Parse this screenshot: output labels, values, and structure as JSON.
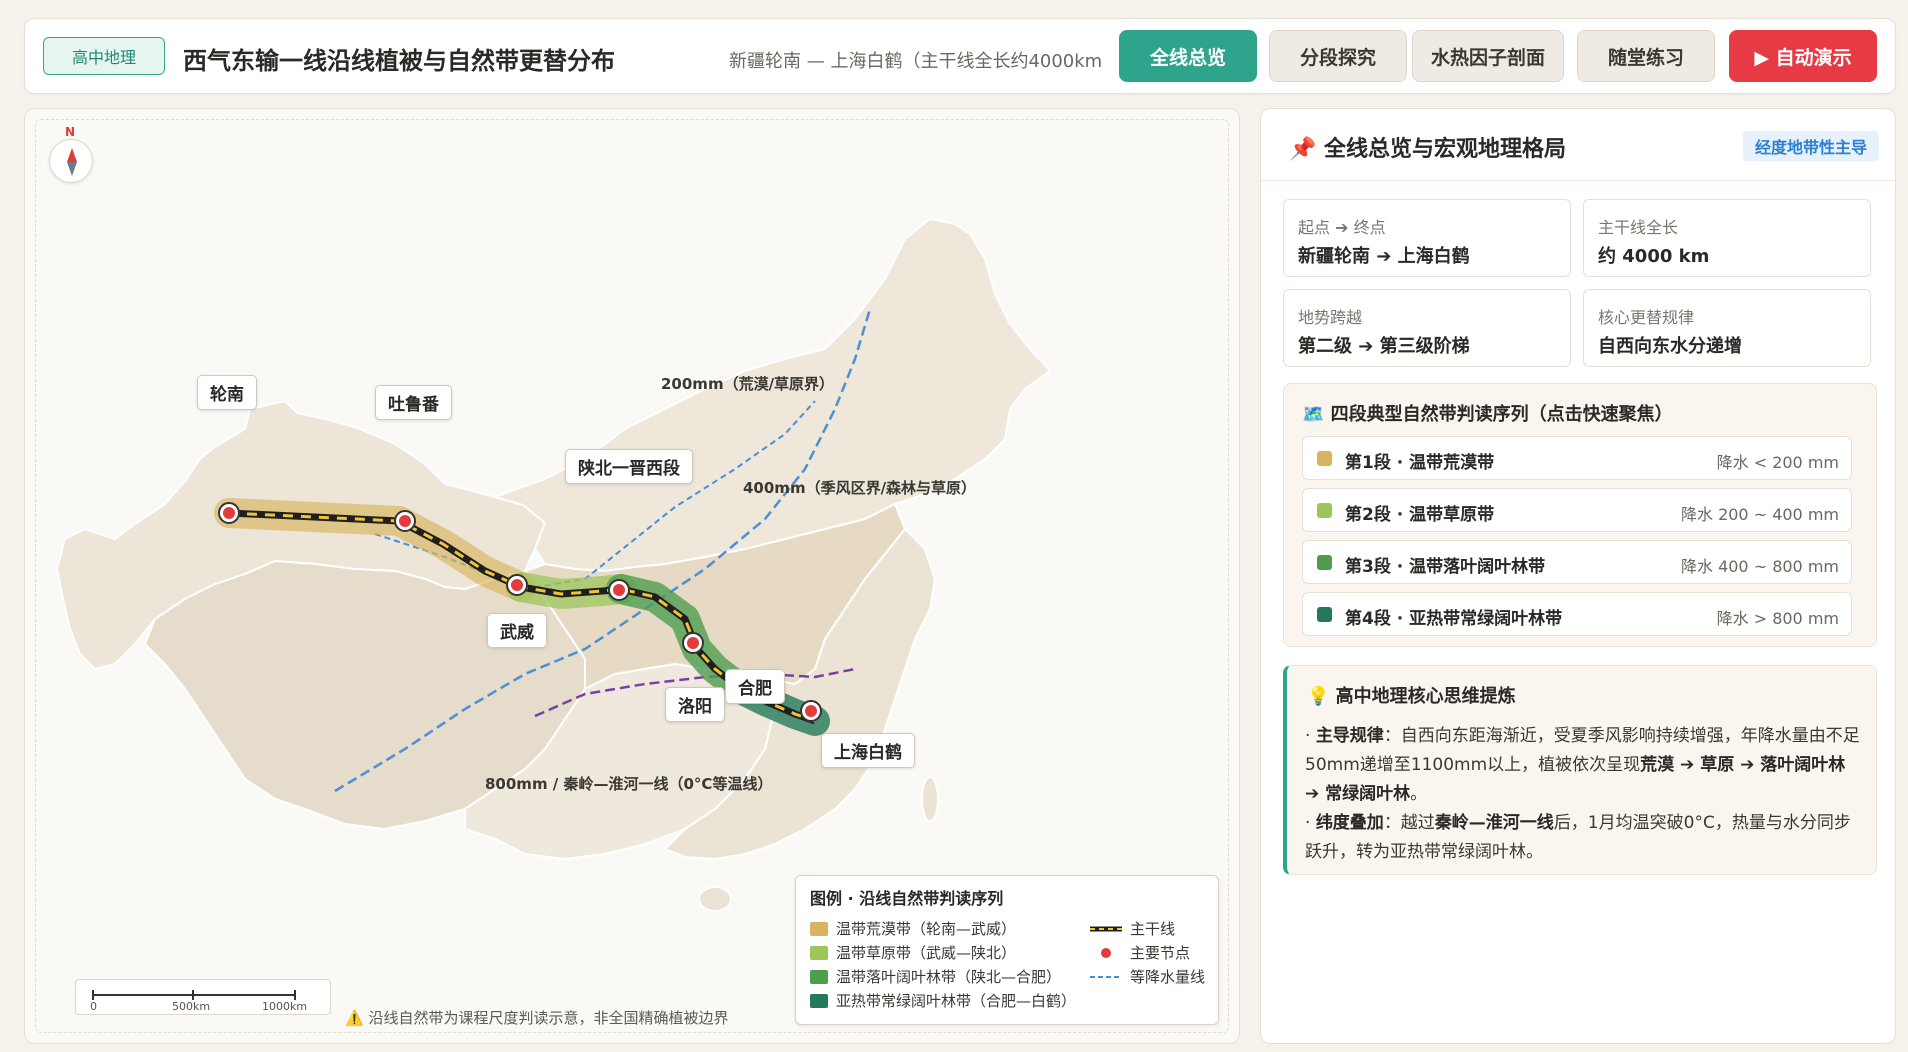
{
  "header": {
    "badge": "高中地理",
    "title": "西气东输一线沿线植被与自然带更替分布",
    "subtitle": "新疆轮南 — 上海白鹤（主干线全长约4000km",
    "nav": [
      "全线总览",
      "分段探究",
      "水热因子剖面",
      "随堂练习"
    ],
    "demo": "▶ 自动演示"
  },
  "map": {
    "compass_n": "N",
    "cities": {
      "lunnan": "轮南",
      "tulufan": "吐鲁番",
      "wuwei": "武威",
      "shanbei": "陕北一晋西段",
      "luoyang": "洛阳",
      "hefei": "合肥",
      "shanghai": "上海白鹤"
    },
    "iso_labels": {
      "l200": "200mm（荒漠/草原界）",
      "l400": "400mm（季风区界/森林与草原）",
      "l800": "800mm / 秦岭—淮河一线（0°C等温线）"
    },
    "scale": {
      "s0": "0",
      "s1": "500km",
      "s2": "1000km"
    },
    "disclaimer": "⚠️ 沿线自然带为课程尺度判读示意，非全国精确植被边界",
    "legend": {
      "title": "图例 · 沿线自然带判读序列",
      "items": [
        "温带荒漠带（轮南—武威）",
        "温带草原带（武威—陕北）",
        "温带落叶阔叶林带（陕北—合肥）",
        "亚热带常绿阔叶林带（合肥—白鹤）"
      ],
      "trunk": "主干线",
      "node": "主要节点",
      "iso": "等降水量线"
    },
    "colors": {
      "desert": "#d9b45e",
      "steppe": "#9cc65a",
      "deciduous": "#4f9c4f",
      "evergreen": "#237a5a"
    }
  },
  "panel": {
    "title": "📌 全线总览与宏观地理格局",
    "badge": "经度地带性主导",
    "stats": [
      {
        "k": "起点 ➔ 终点",
        "v": "新疆轮南 ➔ 上海白鹤"
      },
      {
        "k": "主干线全长",
        "v": "约 4000 km"
      },
      {
        "k": "地势跨越",
        "v": "第二级 ➔ 第三级阶梯"
      },
      {
        "k": "核心更替规律",
        "v": "自西向东水分递增"
      }
    ],
    "seq_title": "🗺️ 四段典型自然带判读序列（点击快速聚焦）",
    "segments": [
      {
        "name": "第1段 · 温带荒漠带",
        "precip": "降水 < 200 mm"
      },
      {
        "name": "第2段 · 温带草原带",
        "precip": "降水 200 ~ 400 mm"
      },
      {
        "name": "第3段 · 温带落叶阔叶林带",
        "precip": "降水 400 ~ 800 mm"
      },
      {
        "name": "第4段 · 亚热带常绿阔叶林带",
        "precip": "降水 > 800 mm"
      }
    ],
    "tip_title": "💡 高中地理核心思维提炼",
    "tip1_label": "主导规律",
    "tip1_text_a": "：自西向东距海渐近，受夏季风影响持续增强，年降水量由不足50mm递增至1100mm以上，植被依次呈现",
    "tip1_b1": "荒漠 ➔ 草原 ➔ 落叶阔叶林 ➔ 常绿阔叶林",
    "tip1_text_c": "。",
    "tip2_label": "纬度叠加",
    "tip2_text_a": "：越过",
    "tip2_b1": "秦岭—淮河一线",
    "tip2_text_b": "后，1月均温突破0°C，热量与水分同步跃升，转为亚热带常绿阔叶林。"
  }
}
